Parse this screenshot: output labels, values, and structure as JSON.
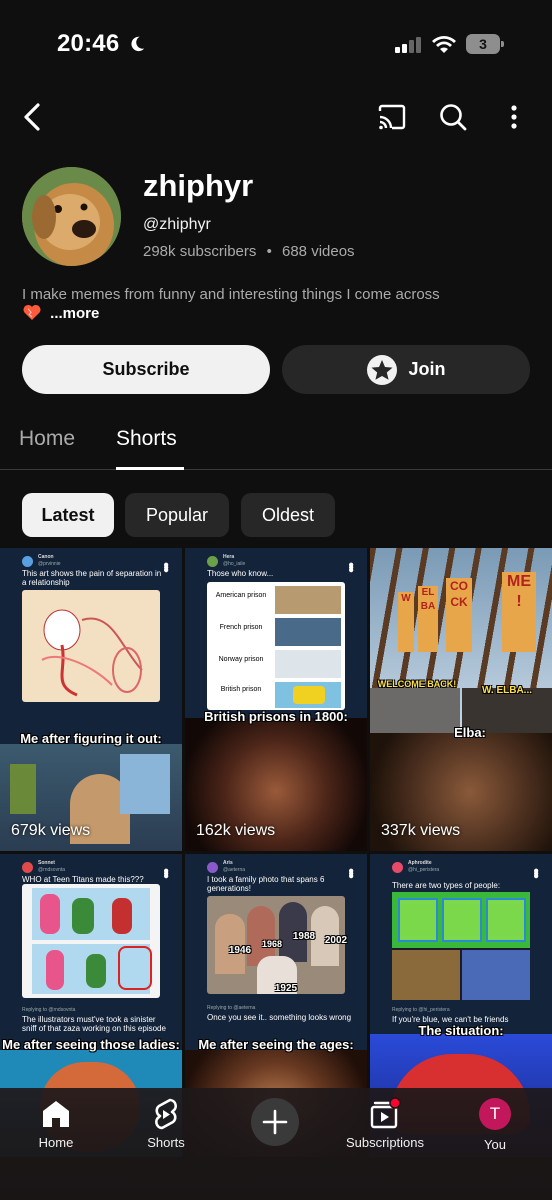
{
  "status_bar": {
    "time": "20:46",
    "battery": "3"
  },
  "channel": {
    "name": "zhiphyr",
    "handle": "@zhiphyr",
    "subscribers": "298k subscribers",
    "separator": "•",
    "videos": "688 videos",
    "description": "I make memes from funny and interesting things I come across",
    "more": "...more"
  },
  "actions": {
    "subscribe": "Subscribe",
    "join": "Join"
  },
  "tabs": [
    {
      "label": "Home"
    },
    {
      "label": "Shorts"
    }
  ],
  "chips": [
    {
      "label": "Latest"
    },
    {
      "label": "Popular"
    },
    {
      "label": "Oldest"
    }
  ],
  "shorts": [
    {
      "post_author": "Canon",
      "post_handle": "@prvinnie",
      "post_text": "This art shows the pain of separation in a relationship",
      "caption": "Me after figuring it out:",
      "views": "679k views"
    },
    {
      "post_author": "Hera",
      "post_handle": "@ho_iaile",
      "post_text": "Those who know...",
      "rows": [
        "American prison",
        "French prison",
        "Norway prison",
        "British prison"
      ],
      "caption": "British prisons in 1800:",
      "views": "162k views"
    },
    {
      "banner_letters": [
        "W",
        "EL",
        "CO",
        "ME"
      ],
      "banner_letters2": [
        "",
        "BA",
        "CK",
        "!"
      ],
      "label_left": "WELCOME BACK!",
      "label_right": "W. ELBA...",
      "caption": "Elba:",
      "views": "337k views"
    },
    {
      "post_author": "Sonnet",
      "post_handle": "@rndsovnta",
      "post_text": "WHO at Teen Titans made this???",
      "reply_label": "Replying to @rndsovnta",
      "reply_text": "The illustrators must've took a sinister sniff of that zaza working on this episode",
      "caption": "Me after seeing those ladies:"
    },
    {
      "post_author": "Aris",
      "post_handle": "@aeterna",
      "post_text": "I took a family photo that spans 6 generations!",
      "years": [
        "1946",
        "1968",
        "1988",
        "2002",
        "1925"
      ],
      "reply_label": "Replying to @aeterna",
      "reply_text": "Once you see it.. something looks wrong",
      "caption": "Me after seeing the ages:"
    },
    {
      "post_author": "Aphrodite",
      "post_handle": "@hi_peristera",
      "post_text": "There are two types of people:",
      "reply_label": "Replying to @hi_peristera",
      "reply_text": "If you're blue, we can't be friends",
      "caption": "The situation:"
    }
  ],
  "bottom_nav": [
    {
      "label": "Home"
    },
    {
      "label": "Shorts"
    },
    {
      "label": ""
    },
    {
      "label": "Subscriptions"
    },
    {
      "label": "You",
      "initial": "T"
    }
  ],
  "colors": {
    "accent": "#ff0033",
    "avatar_bg": "#c2185b",
    "background": "#0f0f0f"
  }
}
